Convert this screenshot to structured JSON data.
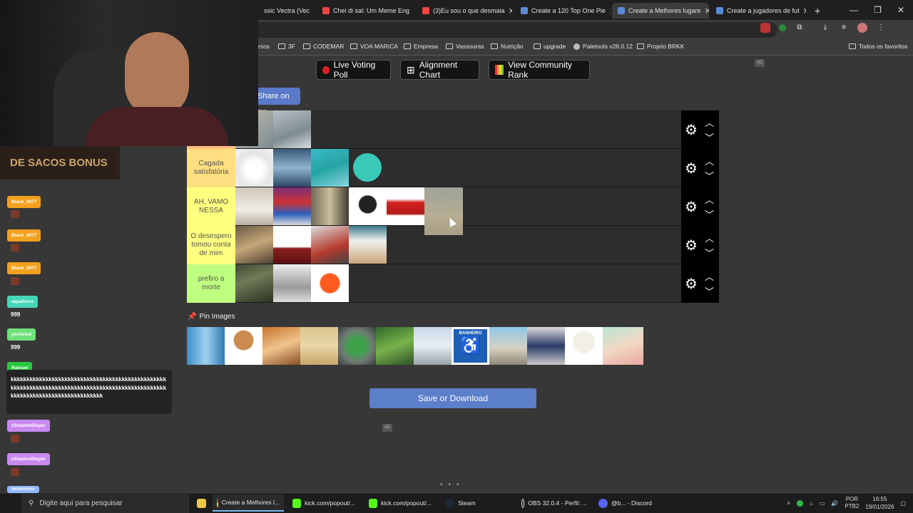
{
  "browser": {
    "tabs": [
      {
        "label": "ssic Vectra (Vec",
        "active": false
      },
      {
        "label": "Chei di sal: Um Meme Eng",
        "active": false
      },
      {
        "label": "(3)Eu sou o que desmaia",
        "active": false
      },
      {
        "label": "Create a 120 Top One Pie",
        "active": false
      },
      {
        "label": "Create a Melhores lugare",
        "active": true
      },
      {
        "label": "Create a jugadores de fut",
        "active": false
      }
    ],
    "new_tab": "+",
    "bookmarks": [
      {
        "label": "rsos",
        "type": "link"
      },
      {
        "label": "3F",
        "type": "folder"
      },
      {
        "label": "CODEMAR",
        "type": "folder"
      },
      {
        "label": "VOA MARICA",
        "type": "folder"
      },
      {
        "label": "Empresa",
        "type": "folder"
      },
      {
        "label": "Vassouras",
        "type": "folder"
      },
      {
        "label": "Nutrição",
        "type": "folder"
      },
      {
        "label": "upgrade",
        "type": "folder"
      },
      {
        "label": "Paletools v26.0.12",
        "type": "link"
      },
      {
        "label": "Projeto BRKK",
        "type": "folder"
      }
    ],
    "all_favorites": "Todos os favoritos"
  },
  "toolbar": {
    "live_voting": "Live Voting Poll",
    "alignment_chart": "Alignment Chart",
    "community_rank": "View Community Rank",
    "share_fb": "Share on FB",
    "ad_label": "AD"
  },
  "tiers": [
    {
      "label": "",
      "color": "#ffbf7f",
      "image_count": 2
    },
    {
      "label": "Cagada satisfatória",
      "color": "#ffdf7f",
      "image_count": 4
    },
    {
      "label": "AH, VAMO NESSA",
      "color": "#ffff7f",
      "image_count": 6
    },
    {
      "label": "O desespero tomou conta de mim",
      "color": "#ffff7f",
      "image_count": 4
    },
    {
      "label": "prefiro a morte",
      "color": "#bfff7f",
      "image_count": 3
    }
  ],
  "pin_images": {
    "title": "Pin Images",
    "count": 12,
    "accessible_sign_text": "BANHEIRO"
  },
  "save_button": "Save or Download",
  "chat": {
    "banner": "DE SACOS BONUS",
    "messages": [
      {
        "user": "Black_6077",
        "text": "",
        "color": "#f2a11f"
      },
      {
        "user": "Black_6077",
        "text": "",
        "color": "#f2a11f"
      },
      {
        "user": "Black_6077",
        "text": "",
        "color": "#f2a11f"
      },
      {
        "user": "aquaforce",
        "text": "999",
        "color": "#45d6b8"
      },
      {
        "user": "yoshebal",
        "text": "999",
        "color": "#6fe07a"
      },
      {
        "user": "Ramsel",
        "text": "kkkkkkkkkkkkkkkkkkkkkkkkkkkkkkkkkkkkkkkkkkkkkkkkkkkkkkkkkkkkkkkkkkkkkkkkkkkkkkkkkkkkkkkkkkkkkkkkkkkkkkkkkkkkkkkkkkkkkkkkkkkkkkk",
        "color": "#28c940"
      },
      {
        "user": "zShadowSlayer",
        "text": "",
        "color": "#c98af0"
      },
      {
        "user": "zShadowSlayer",
        "text": "",
        "color": "#c98af0"
      },
      {
        "user": "belmontcs",
        "text": "",
        "color": "#8fb8ff"
      }
    ]
  },
  "taskbar": {
    "search_placeholder": "Digite aqui para pesquisar",
    "tasks": [
      {
        "label": "Create a Melhores l..."
      },
      {
        "label": "kick.com/popout/..."
      },
      {
        "label": "kick.com/popout/..."
      },
      {
        "label": "Steam"
      },
      {
        "label": "OBS 32.0.4 - Perfil: ..."
      },
      {
        "label": "@b... - Discord"
      }
    ],
    "lang_line1": "POR",
    "lang_line2": "PTB2",
    "time": "16:55",
    "date": "19/01/2026"
  }
}
